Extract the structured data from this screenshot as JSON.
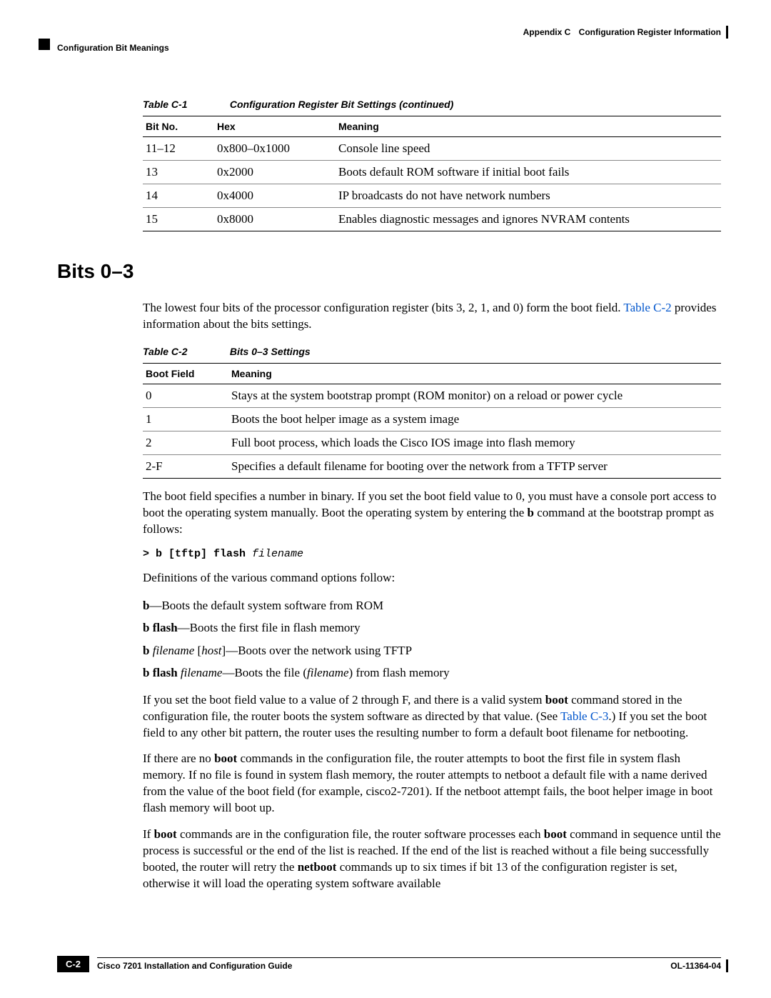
{
  "header": {
    "appendix": "Appendix C",
    "appendix_title": "Configuration Register Information",
    "section": "Configuration Bit Meanings"
  },
  "table1": {
    "label": "Table C-1",
    "title": "Configuration Register Bit Settings (continued)",
    "head": {
      "c1": "Bit No.",
      "c2": "Hex",
      "c3": "Meaning"
    },
    "rows": [
      {
        "c1": "11–12",
        "c2": "0x800–0x1000",
        "c3": "Console line speed"
      },
      {
        "c1": "13",
        "c2": "0x2000",
        "c3": "Boots default ROM software if initial boot fails"
      },
      {
        "c1": "14",
        "c2": "0x4000",
        "c3": "IP broadcasts do not have network numbers"
      },
      {
        "c1": "15",
        "c2": "0x8000",
        "c3": "Enables diagnostic messages and ignores NVRAM contents"
      }
    ]
  },
  "section_heading": "Bits 0–3",
  "para_intro_a": "The lowest four bits of the processor configuration register (bits 3, 2, 1, and 0) form the boot field. ",
  "xref_c2": "Table C-2",
  "para_intro_b": " provides information about the bits settings.",
  "table2": {
    "label": "Table C-2",
    "title": "Bits 0–3 Settings",
    "head": {
      "c1": "Boot Field",
      "c2": "Meaning"
    },
    "rows": [
      {
        "c1": "0",
        "c2": "Stays at the system bootstrap prompt (ROM monitor) on a reload or power cycle"
      },
      {
        "c1": "1",
        "c2": "Boots the boot helper image as a system image"
      },
      {
        "c1": "2",
        "c2": "Full boot process, which loads the Cisco IOS image into flash memory"
      },
      {
        "c1": "2-F",
        "c2": "Specifies a default filename for booting over the network from a TFTP server"
      }
    ]
  },
  "para_bootfield_a": "The boot field specifies a number in binary. If you set the boot field value to 0, you must have a console port access to boot the operating system manually. Boot the operating system by entering the ",
  "kw_b": "b",
  "para_bootfield_b": " command at the bootstrap prompt as follows:",
  "cmd": {
    "prefix": "> b [tftp] flash ",
    "arg": "filename"
  },
  "para_defs_intro": "Definitions of the various command options follow:",
  "defs": {
    "r1": {
      "term": "b",
      "sep": "—",
      "desc": "Boots the default system software from ROM"
    },
    "r2": {
      "term": "b flash",
      "sep": "—",
      "desc": "Boots the first file in flash memory"
    },
    "r3": {
      "term1": "b ",
      "ital1": "filename",
      "mid": " [",
      "ital2": "host",
      "post": "]",
      "sep": "—",
      "desc": "Boots over the network using TFTP"
    },
    "r4": {
      "term": "b flash ",
      "ital": "filename",
      "sep": "—",
      "desc_a": "Boots the file (",
      "desc_i": "filename",
      "desc_b": ") from flash memory"
    }
  },
  "para_p3_a": "If you set the boot field value to a value of 2 through F, and there is a valid system ",
  "kw_boot": "boot",
  "para_p3_b": " command stored in the configuration file, the router boots the system software as directed by that value. (See ",
  "xref_c3": "Table C-3",
  "para_p3_c": ".) If you set the boot field to any other bit pattern, the router uses the resulting number to form a default boot filename for netbooting.",
  "para_p4_a": "If there are no ",
  "para_p4_b": " commands in the configuration file, the router attempts to boot the first file in system flash memory. If no file is found in system flash memory, the router attempts to netboot a default file with a name derived from the value of the boot field (for example, cisco2-7201). If the netboot attempt fails, the boot helper image in boot flash memory will boot up.",
  "para_p5_a": "If ",
  "para_p5_b": " commands are in the configuration file, the router software processes each ",
  "para_p5_c": " command in sequence until the process is successful or the end of the list is reached. If the end of the list is reached without a file being successfully booted, the router will retry the ",
  "kw_netboot": "netboot",
  "para_p5_d": " commands up to six times if bit 13 of the configuration register is set, otherwise it will load the operating system software available",
  "footer": {
    "guide": "Cisco 7201 Installation and Configuration Guide",
    "page": "C-2",
    "doc": "OL-11364-04"
  }
}
